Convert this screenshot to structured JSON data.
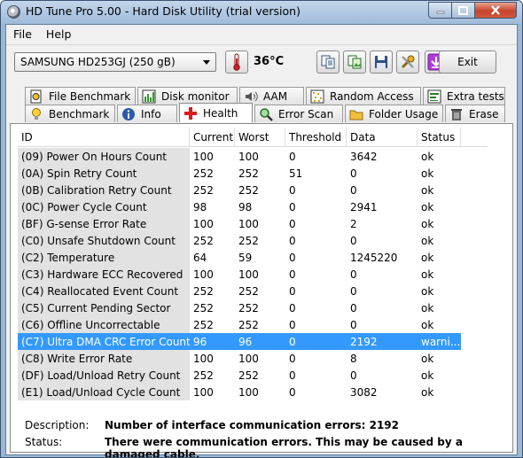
{
  "window": {
    "title": "HD Tune Pro 5.00 - Hard Disk Utility (trial version)"
  },
  "menu": [
    "File",
    "Help"
  ],
  "toolbar": {
    "drive": "SAMSUNG HD253GJ (250 gB)",
    "temperature": "36°C",
    "exit_label": "Exit"
  },
  "tabs_row1": [
    "File Benchmark",
    "Disk monitor",
    "AAM",
    "Random Access",
    "Extra tests"
  ],
  "tabs_row2": [
    "Benchmark",
    "Info",
    "Health",
    "Error Scan",
    "Folder Usage",
    "Erase"
  ],
  "table": {
    "columns": [
      "ID",
      "Current",
      "Worst",
      "Threshold",
      "Data",
      "Status"
    ],
    "rows": [
      [
        "(09) Power On Hours Count",
        "100",
        "100",
        "0",
        "3642",
        "ok"
      ],
      [
        "(0A) Spin Retry Count",
        "252",
        "252",
        "51",
        "0",
        "ok"
      ],
      [
        "(0B) Calibration Retry Count",
        "252",
        "252",
        "0",
        "0",
        "ok"
      ],
      [
        "(0C) Power Cycle Count",
        "98",
        "98",
        "0",
        "2941",
        "ok"
      ],
      [
        "(BF) G-sense Error Rate",
        "100",
        "100",
        "0",
        "2",
        "ok"
      ],
      [
        "(C0) Unsafe Shutdown Count",
        "252",
        "252",
        "0",
        "0",
        "ok"
      ],
      [
        "(C2) Temperature",
        "64",
        "59",
        "0",
        "1245220",
        "ok"
      ],
      [
        "(C3) Hardware ECC Recovered",
        "100",
        "100",
        "0",
        "0",
        "ok"
      ],
      [
        "(C4) Reallocated Event Count",
        "252",
        "252",
        "0",
        "0",
        "ok"
      ],
      [
        "(C5) Current Pending Sector",
        "252",
        "252",
        "0",
        "0",
        "ok"
      ],
      [
        "(C6) Offline Uncorrectable",
        "252",
        "252",
        "0",
        "0",
        "ok"
      ],
      [
        "(C7) Ultra DMA CRC Error Count",
        "96",
        "96",
        "0",
        "2192",
        "warni..."
      ],
      [
        "(C8) Write Error Rate",
        "100",
        "100",
        "0",
        "8",
        "ok"
      ],
      [
        "(DF) Load/Unload Retry Count",
        "252",
        "252",
        "0",
        "0",
        "ok"
      ],
      [
        "(E1) Load/Unload Cycle Count",
        "100",
        "100",
        "0",
        "3082",
        "ok"
      ]
    ],
    "selected_row": "(C7) Ultra DMA CRC Error Count"
  },
  "details": {
    "description_label": "Description:",
    "description": "Number of interface communication errors: 2192",
    "status_label": "Status:",
    "status": "There were communication errors. This may be caused by a damaged cable."
  },
  "colors": {
    "selection": "#3399ff",
    "id_column": "#e2e2e2",
    "close_button": "#c7432b"
  }
}
